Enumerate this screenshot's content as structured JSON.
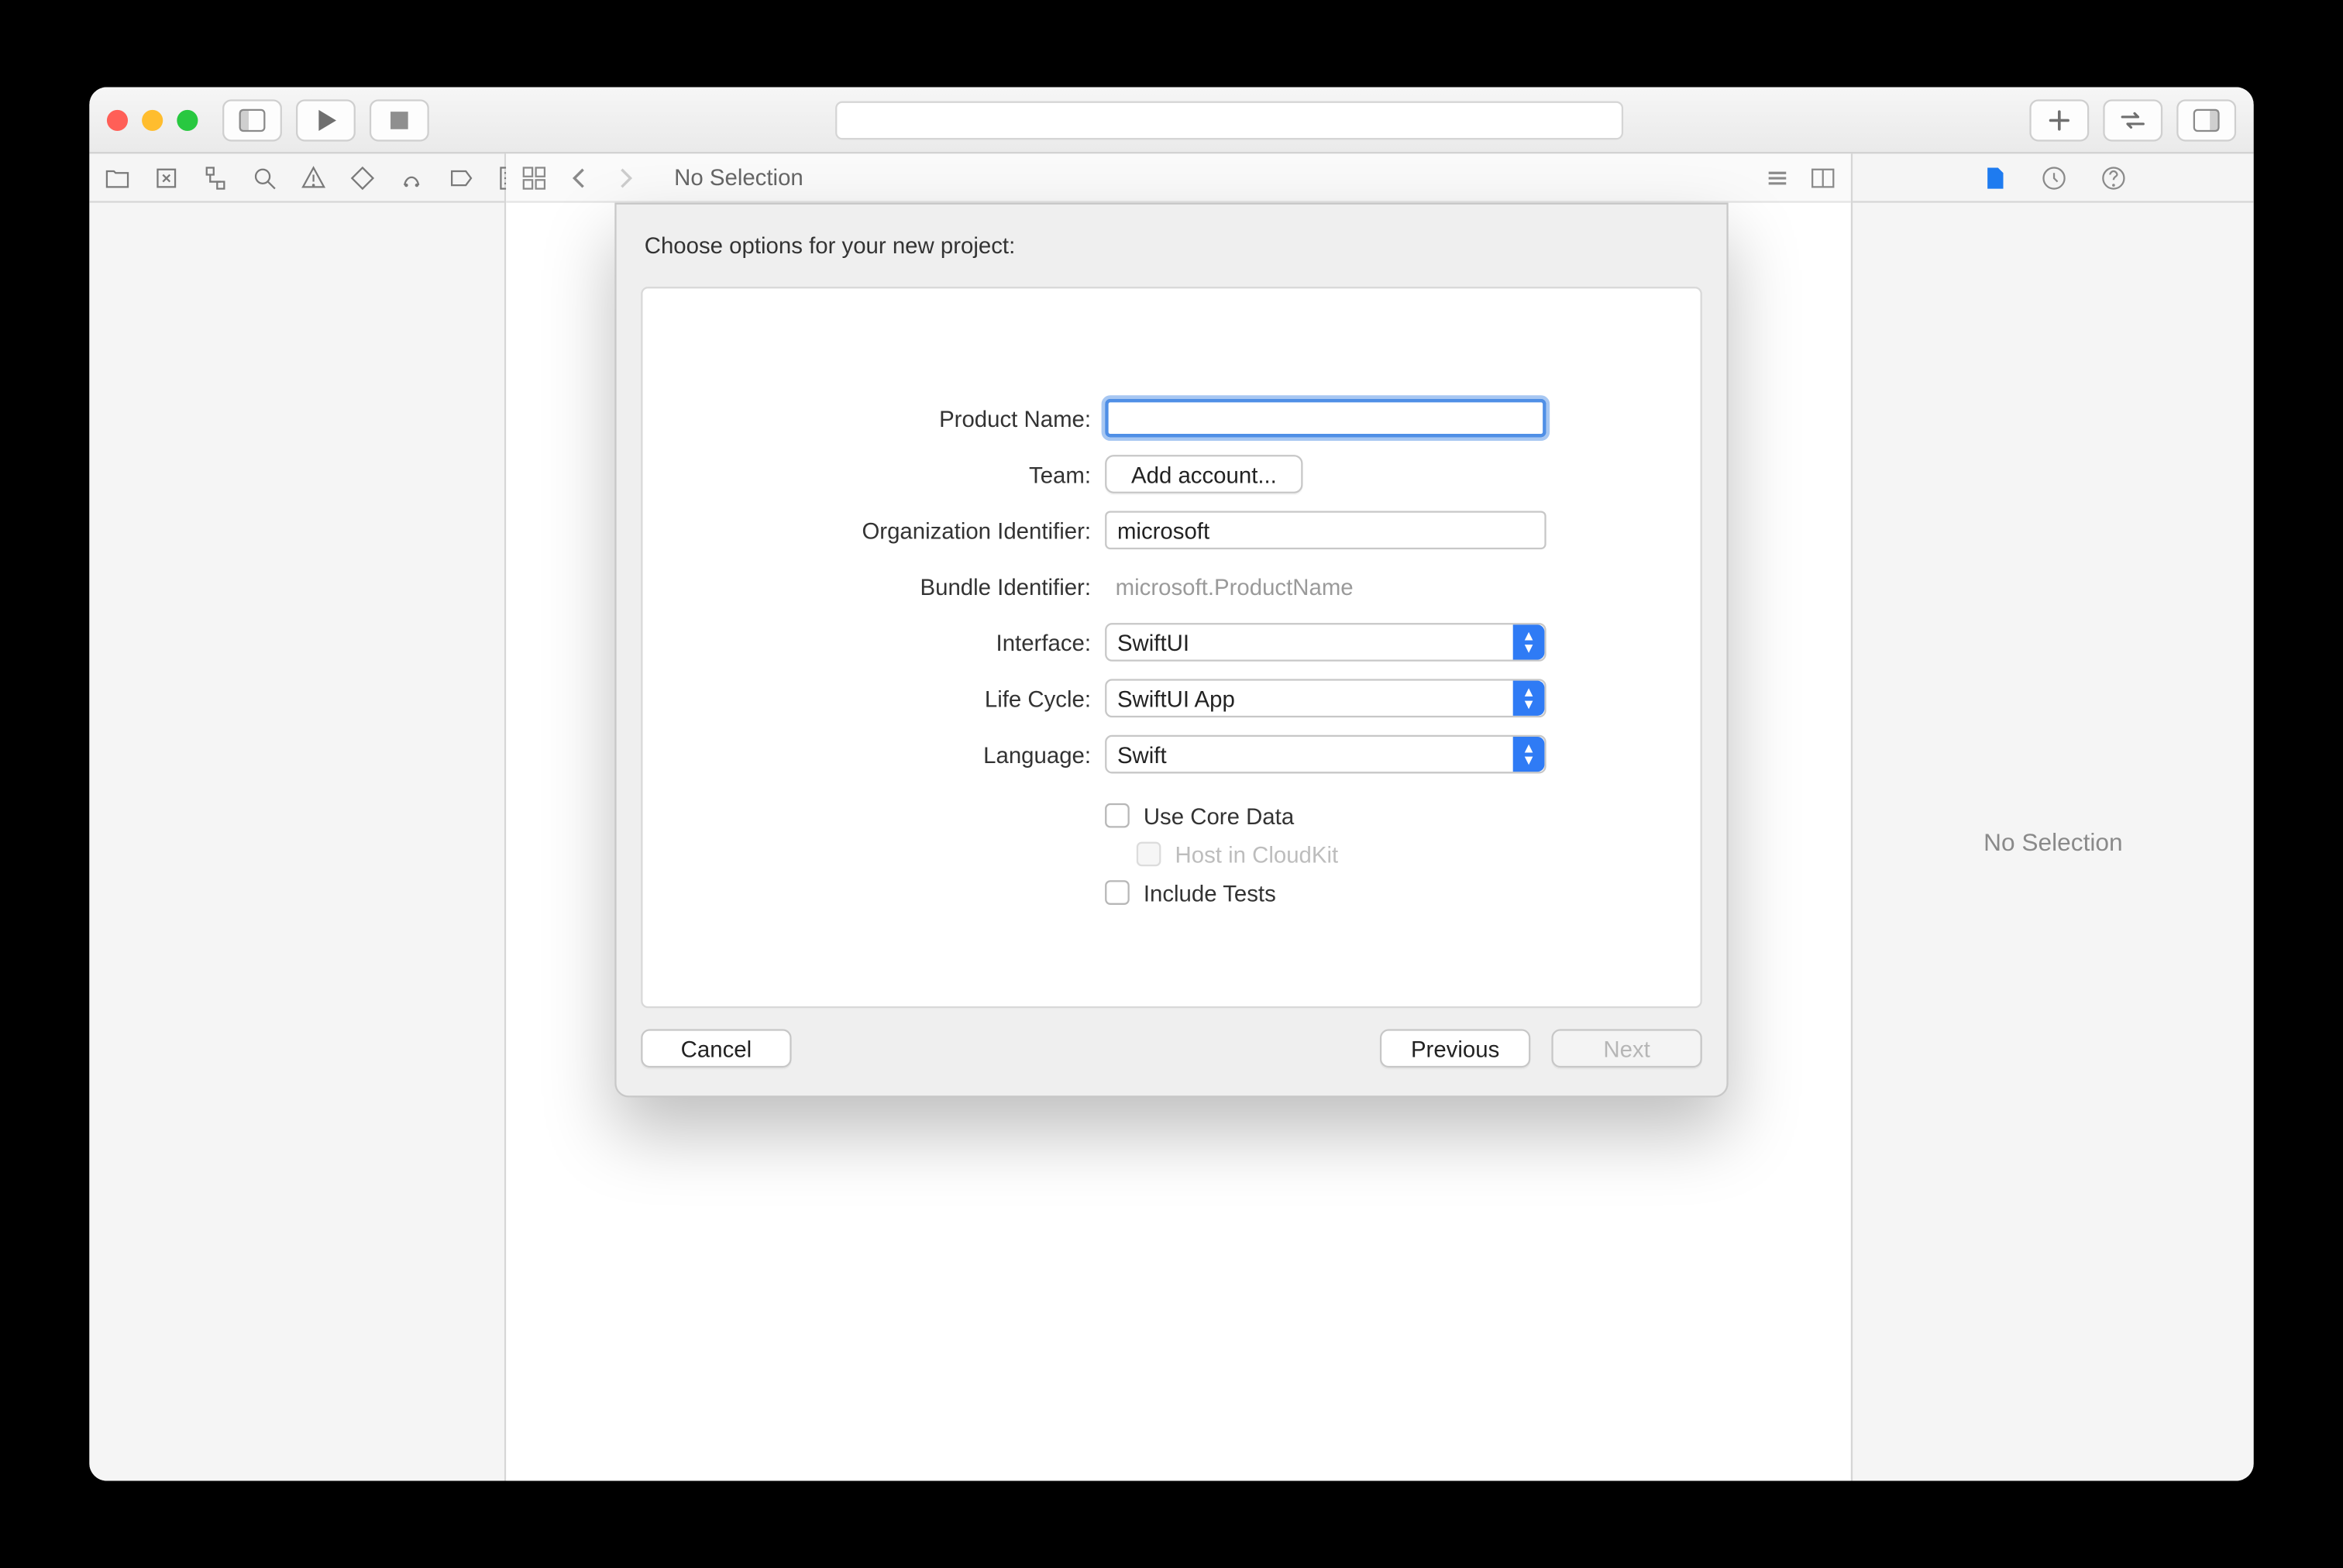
{
  "editor_bar": {
    "no_selection": "No Selection"
  },
  "inspector": {
    "no_selection": "No Selection"
  },
  "sheet": {
    "title": "Choose options for your new project:",
    "product_name": {
      "label": "Product Name:",
      "value": ""
    },
    "team": {
      "label": "Team:",
      "button": "Add account..."
    },
    "org_id": {
      "label": "Organization Identifier:",
      "value": "microsoft"
    },
    "bundle_id": {
      "label": "Bundle Identifier:",
      "value": "microsoft.ProductName"
    },
    "interface": {
      "label": "Interface:",
      "value": "SwiftUI"
    },
    "lifecycle": {
      "label": "Life Cycle:",
      "value": "SwiftUI App"
    },
    "language": {
      "label": "Language:",
      "value": "Swift"
    },
    "use_core_data": {
      "label": "Use Core Data",
      "checked": false
    },
    "host_cloudkit": {
      "label": "Host in CloudKit",
      "checked": false,
      "disabled": true
    },
    "include_tests": {
      "label": "Include Tests",
      "checked": false
    },
    "buttons": {
      "cancel": "Cancel",
      "previous": "Previous",
      "next": "Next"
    }
  }
}
